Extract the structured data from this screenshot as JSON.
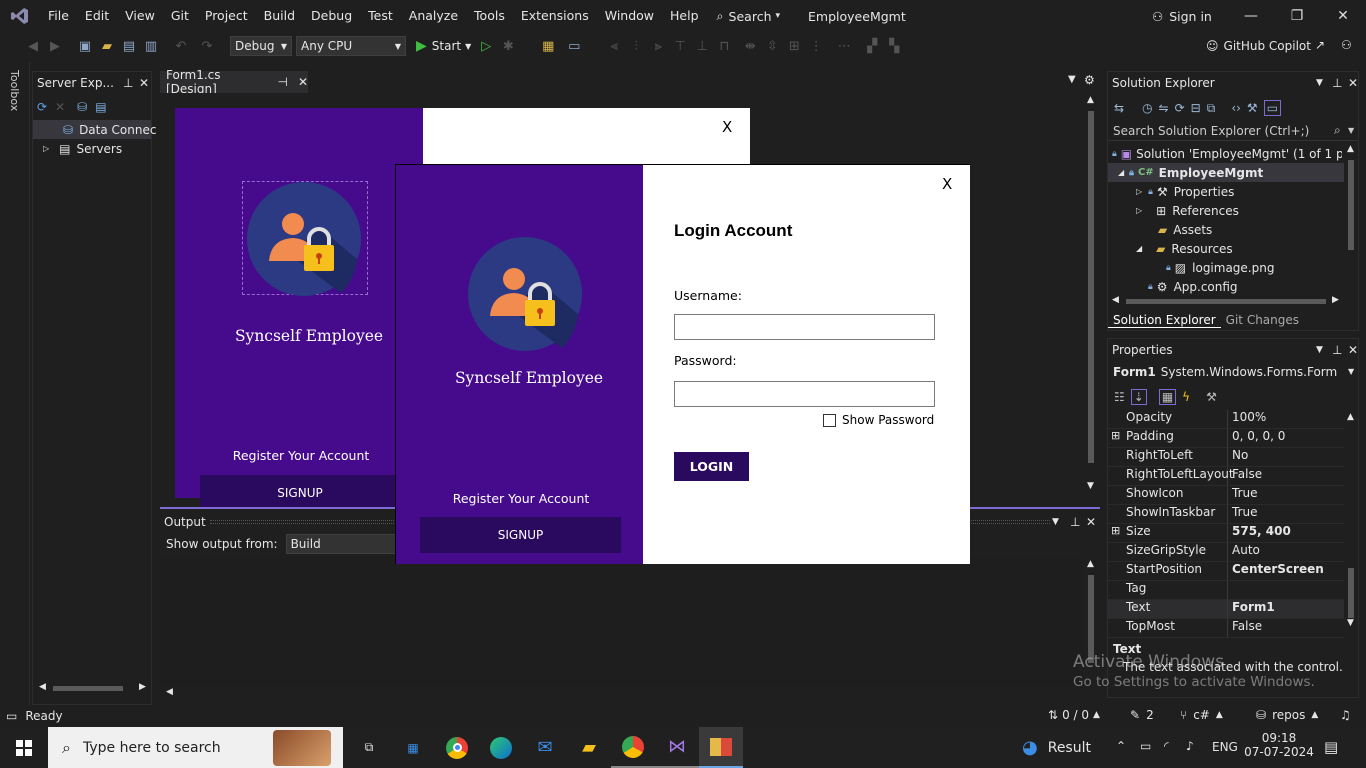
{
  "menu": [
    "File",
    "Edit",
    "View",
    "Git",
    "Project",
    "Build",
    "Debug",
    "Test",
    "Analyze",
    "Tools",
    "Extensions",
    "Window",
    "Help"
  ],
  "search_label": "Search",
  "solution_title": "EmployeeMgmt",
  "sign_in": "Sign in",
  "toolbar": {
    "config": "Debug",
    "platform": "Any CPU",
    "start": "Start",
    "copilot": "GitHub Copilot"
  },
  "toolbox_label": "Toolbox",
  "server_explorer": {
    "title": "Server Exp...",
    "items": [
      "Data Connec",
      "Servers"
    ]
  },
  "doc_tab": "Form1.cs [Design]",
  "back_form": {
    "app_name": "Syncself Employee",
    "register": "Register Your Account",
    "signup": "SIGNUP",
    "close": "X"
  },
  "login_form": {
    "app_name": "Syncself Employee",
    "register": "Register Your Account",
    "signup": "SIGNUP",
    "close": "X",
    "title": "Login Account",
    "username_label": "Username:",
    "password_label": "Password:",
    "show_password": "Show Password",
    "login": "LOGIN"
  },
  "solution_explorer": {
    "title": "Solution Explorer",
    "search_placeholder": "Search Solution Explorer (Ctrl+;)",
    "items": [
      "Solution 'EmployeeMgmt' (1 of 1 proje",
      "EmployeeMgmt",
      "Properties",
      "References",
      "Assets",
      "Resources",
      "logimage.png",
      "App.config"
    ],
    "tabs": [
      "Solution Explorer",
      "Git Changes"
    ]
  },
  "properties": {
    "title": "Properties",
    "object": "Form1",
    "object_type": "System.Windows.Forms.Form",
    "rows": [
      {
        "name": "Opacity",
        "value": "100%"
      },
      {
        "name": "Padding",
        "value": "0, 0, 0, 0"
      },
      {
        "name": "RightToLeft",
        "value": "No"
      },
      {
        "name": "RightToLeftLayout",
        "value": "False"
      },
      {
        "name": "ShowIcon",
        "value": "True"
      },
      {
        "name": "ShowInTaskbar",
        "value": "True"
      },
      {
        "name": "Size",
        "value": "575, 400"
      },
      {
        "name": "SizeGripStyle",
        "value": "Auto"
      },
      {
        "name": "StartPosition",
        "value": "CenterScreen"
      },
      {
        "name": "Tag",
        "value": ""
      },
      {
        "name": "Text",
        "value": "Form1"
      },
      {
        "name": "TopMost",
        "value": "False"
      }
    ],
    "desc_title": "Text",
    "desc_text": "The text associated with the control."
  },
  "activate": {
    "line1": "Activate Windows",
    "line2": "Go to Settings to activate Windows."
  },
  "output": {
    "title": "Output",
    "show_from": "Show output from:",
    "source": "Build"
  },
  "status": {
    "ready": "Ready",
    "changes": "0 / 0",
    "edits": "2",
    "lang": "c#",
    "repo": "repos"
  },
  "taskbar": {
    "search": "Type here to search",
    "result": "Result",
    "lang": "ENG",
    "time": "09:18",
    "date": "07-07-2024"
  }
}
